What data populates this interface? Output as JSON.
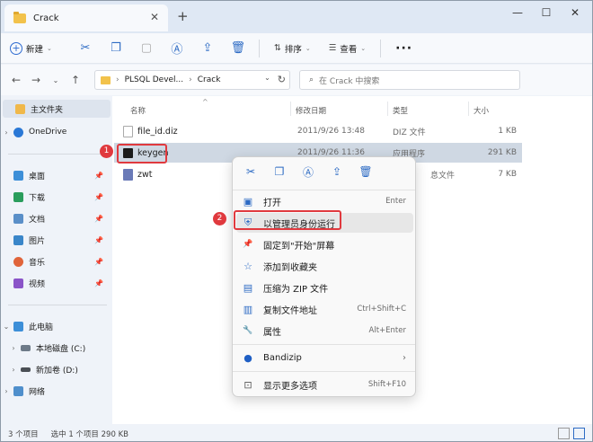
{
  "window": {
    "tab_title": "Crack",
    "tab_close": "✕",
    "new_tab": "+",
    "min": "—",
    "max": "☐",
    "close": "✕"
  },
  "toolbar": {
    "new_label": "新建",
    "sort_label": "排序",
    "view_label": "查看",
    "more": "···"
  },
  "nav": {
    "path": [
      "PLSQL Devel...",
      "Crack"
    ],
    "search_placeholder": "在 Crack 中搜索"
  },
  "sidebar": {
    "home": "主文件夹",
    "onedrive": "OneDrive",
    "quick": [
      "桌面",
      "下载",
      "文档",
      "图片",
      "音乐",
      "视频"
    ],
    "this_pc": "此电脑",
    "drives": [
      "本地磁盘 (C:)",
      "新加卷 (D:)"
    ],
    "network": "网络"
  },
  "columns": {
    "name": "名称",
    "date": "修改日期",
    "type": "类型",
    "size": "大小"
  },
  "files": [
    {
      "name": "file_id.diz",
      "date": "2011/9/26 13:48",
      "type": "DIZ 文件",
      "size": "1 KB"
    },
    {
      "name": "keygen",
      "date": "2011/9/26 11:36",
      "type": "应用程序",
      "size": "291 KB"
    },
    {
      "name": "zwt",
      "date": "",
      "type": "息文件",
      "size": "7 KB"
    }
  ],
  "context_menu": {
    "items": [
      {
        "label": "打开",
        "shortcut": "Enter",
        "icon": "▣"
      },
      {
        "label": "以管理员身份运行",
        "shortcut": "",
        "icon": "⛨"
      },
      {
        "label": "固定到\"开始\"屏幕",
        "shortcut": "",
        "icon": "📌"
      },
      {
        "label": "添加到收藏夹",
        "shortcut": "",
        "icon": "☆"
      },
      {
        "label": "压缩为 ZIP 文件",
        "shortcut": "",
        "icon": "▤"
      },
      {
        "label": "复制文件地址",
        "shortcut": "Ctrl+Shift+C",
        "icon": "▥"
      },
      {
        "label": "属性",
        "shortcut": "Alt+Enter",
        "icon": "🔧"
      }
    ],
    "bandizip": "Bandizip",
    "more_options": "显示更多选项",
    "more_shortcut": "Shift+F10"
  },
  "annotations": {
    "badge1": "1",
    "badge2": "2"
  },
  "status": {
    "count": "3 个项目",
    "selected": "选中 1 个项目  290 KB"
  }
}
